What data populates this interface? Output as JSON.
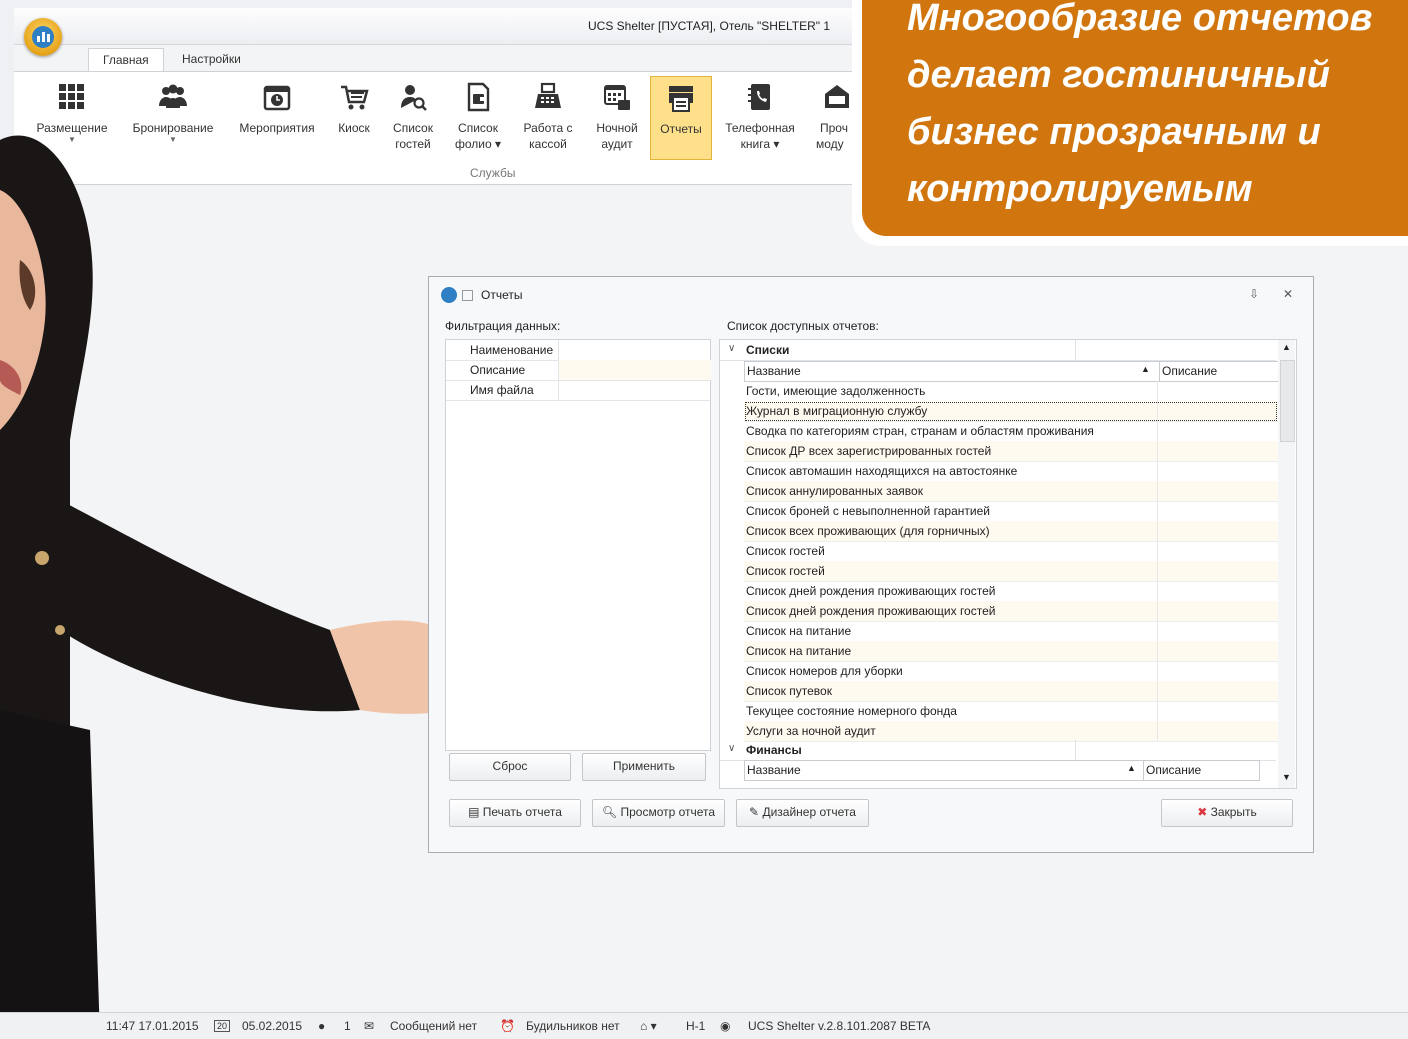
{
  "window": {
    "title": "UCS Shelter [ПУСТАЯ], Отель \"SHELTER\" 1"
  },
  "tabs": [
    {
      "label": "Главная",
      "active": true
    },
    {
      "label": "Настройки",
      "active": false
    }
  ],
  "ribbon": {
    "buttons": [
      {
        "label": "Размещение",
        "label2": "",
        "dropdown": true,
        "icon": "layout-grid-icon"
      },
      {
        "label": "Бронирование",
        "label2": "",
        "dropdown": true,
        "icon": "users-icon"
      },
      {
        "label": "Мероприятия",
        "label2": "",
        "dropdown": false,
        "icon": "calendar-clock-icon"
      },
      {
        "label": "Киоск",
        "label2": "",
        "dropdown": false,
        "icon": "cart-icon"
      },
      {
        "label": "Список",
        "label2": "гостей",
        "dropdown": false,
        "icon": "guest-search-icon"
      },
      {
        "label": "Список",
        "label2": "фолио ▾",
        "dropdown": false,
        "icon": "folio-icon"
      },
      {
        "label": "Работа с",
        "label2": "кассой",
        "dropdown": false,
        "icon": "cash-register-icon"
      },
      {
        "label": "Ночной",
        "label2": "аудит",
        "dropdown": false,
        "icon": "night-audit-icon"
      },
      {
        "label": "Отчеты",
        "label2": "",
        "dropdown": false,
        "icon": "reports-printer-icon",
        "active": true
      },
      {
        "label": "Телефонная",
        "label2": "книга ▾",
        "dropdown": false,
        "icon": "phone-book-icon"
      },
      {
        "label": "Проч",
        "label2": "моду",
        "dropdown": false,
        "icon": "modules-icon"
      }
    ],
    "group_label": "Службы"
  },
  "banner": {
    "lines": [
      "Многообразие отчетов",
      "делает гостиничный",
      "бизнес прозрачным и",
      "контролируемым"
    ]
  },
  "dialog": {
    "title": "Отчеты",
    "filter_label": "Фильтрация данных:",
    "filter_fields": [
      "Наименование",
      "Описание",
      "Имя файла"
    ],
    "reset_button": "Сброс",
    "apply_button": "Применить",
    "list_label": "Список доступных отчетов:",
    "groups": [
      {
        "name": "Списки",
        "col_name": "Название",
        "col_desc": "Описание",
        "rows": [
          "Гости, имеющие задолженность",
          "Журнал в миграционную службу",
          "Сводка по категориям стран, странам и областям проживания",
          "Список ДР всех зарегистрированных гостей",
          "Список автомашин находящихся на автостоянке",
          "Список аннулированных заявок",
          "Список броней с невыполненной гарантией",
          "Список всех проживающих (для горничных)",
          "Список гостей",
          "Список гостей",
          "Список дней рождения проживающих гостей",
          "Список дней рождения проживающих гостей",
          "Список на питание",
          "Список на питание",
          "Список номеров для уборки",
          "Список путевок",
          "Текущее состояние номерного фонда",
          "Услуги за ночной аудит"
        ]
      },
      {
        "name": "Финансы",
        "col_name": "Название",
        "col_desc": "Описание",
        "rows": []
      }
    ],
    "print_button": "Печать отчета",
    "preview_button": "Просмотр отчета",
    "designer_button": "Дизайнер отчета",
    "close_button": "Закрыть"
  },
  "statusbar": {
    "datetime": "11:47 17.01.2015",
    "date": "05.02.2015",
    "users": "1",
    "messages": "Сообщений нет",
    "alarms": "Будильников нет",
    "hotel": "Н-1",
    "version": "UCS Shelter v.2.8.101.2087 BETA"
  },
  "colors": {
    "accent": "#d1750f",
    "ribbon_active": "#ffe08a",
    "row_alt": "#fffaf0"
  }
}
